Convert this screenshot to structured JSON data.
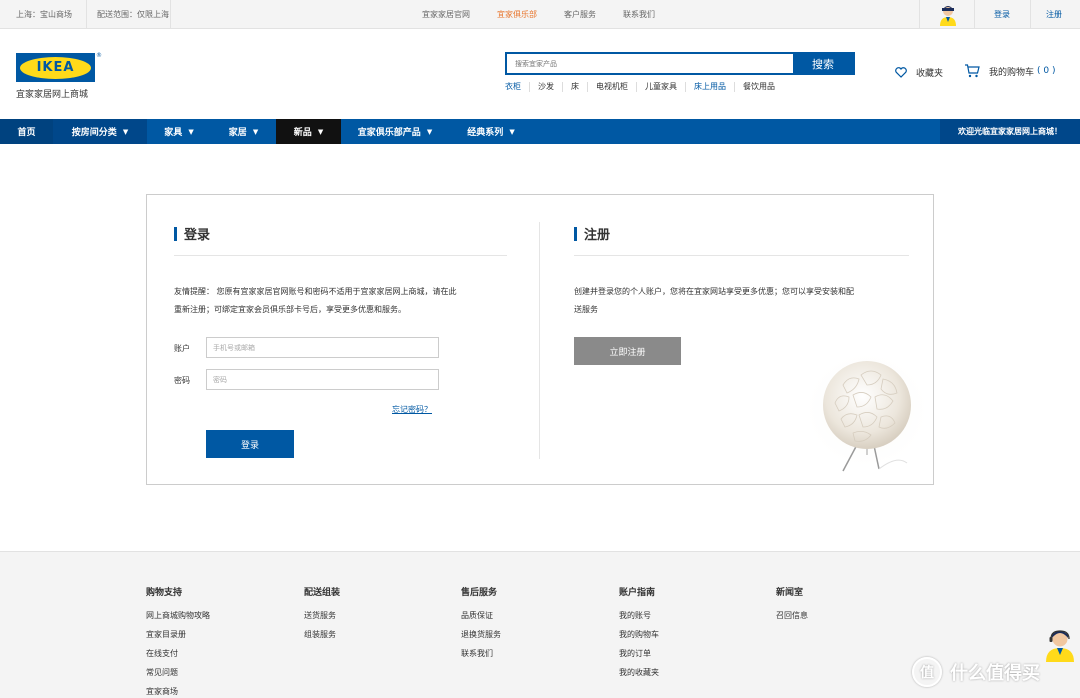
{
  "topbar": {
    "location": "上海：宝山商场",
    "delivery": "配送范围：仅限上海",
    "links": [
      "宜家家居官网",
      "宜家俱乐部",
      "客户服务",
      "联系我们"
    ],
    "active_link_index": 1,
    "login": "登录",
    "register": "注册"
  },
  "header": {
    "logo_text": "IKEA",
    "logo_reg": "®",
    "logo_caption": "宜家家居网上商城",
    "search_placeholder": "搜索宜家产品",
    "search_button": "搜索",
    "hotwords": [
      "衣柜",
      "沙发",
      "床",
      "电视机柜",
      "儿童家具",
      "床上用品",
      "餐饮用品"
    ],
    "hotwords_highlighted": [
      0,
      5
    ],
    "favorites": "收藏夹",
    "cart": "我的购物车",
    "cart_count": "( 0 )"
  },
  "nav": {
    "items": [
      "首页",
      "按房间分类",
      "家具",
      "家居",
      "新品",
      "宜家俱乐部产品",
      "经典系列"
    ],
    "welcome": "欢迎光临宜家家居网上商城！"
  },
  "login": {
    "title": "登录",
    "tip_line1": "友情提醒：  您原有宜家家居官网账号和密码不适用于宜家家居网上商城，请在此",
    "tip_line2": "重新注册；可绑定宜家会员俱乐部卡号后，享受更多优惠和服务。",
    "account_label": "账户",
    "account_placeholder": "手机号或邮箱",
    "password_label": "密码",
    "password_placeholder": "密码",
    "forgot": "忘记密码？",
    "submit": "登录"
  },
  "register": {
    "title": "注册",
    "desc_line1": "创建并登录您的个人账户，您将在宜家网站享受更多优惠；您可以享受安装和配",
    "desc_line2": "送服务",
    "button": "立即注册"
  },
  "footer": {
    "columns": [
      {
        "heading": "购物支持",
        "links": [
          "网上商城购物攻略",
          "宜家目录册",
          "在线支付",
          "常见问题",
          "宜家商场"
        ]
      },
      {
        "heading": "配送组装",
        "links": [
          "送货服务",
          "组装服务"
        ]
      },
      {
        "heading": "售后服务",
        "links": [
          "品质保证",
          "退换货服务",
          "联系我们"
        ]
      },
      {
        "heading": "账户指南",
        "links": [
          "我的账号",
          "我的购物车",
          "我的订单",
          "我的收藏夹"
        ]
      },
      {
        "heading": "新闻室",
        "links": [
          "召回信息"
        ]
      }
    ]
  },
  "watermark": "什么值得买",
  "colors": {
    "brand_blue": "#0058a3",
    "brand_yellow": "#ffda1a",
    "active_orange": "#e8752c",
    "nav_dark": "#111111",
    "register_gray": "#8a8a8a"
  }
}
